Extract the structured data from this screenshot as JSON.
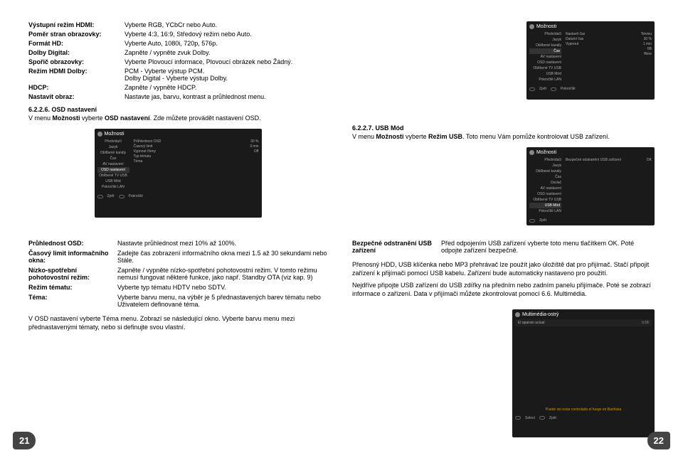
{
  "table1": {
    "rows": [
      {
        "key": "Výstupní režim HDMI:",
        "val": "Vyberte RGB, YCbCr nebo Auto."
      },
      {
        "key": "Poměr stran obrazovky:",
        "val": "Vyberte 4:3, 16:9, Středový režim nebo Auto."
      },
      {
        "key": "Formát HD:",
        "val": "Vyberte Auto, 1080i, 720p, 576p."
      },
      {
        "key": "Dolby Digital:",
        "val": "Zapněte / vypněte zvuk Dolby."
      },
      {
        "key": "Spořič obrazovky:",
        "val": "Vyberte Plovoucí informace, Plovoucí obrázek nebo Žádný."
      },
      {
        "key": "Režim HDMI Dolby:",
        "val": "PCM - Vyberte výstup PCM.\nDolby Digital - Vyberte výstup Dolby."
      },
      {
        "key": "HDCP:",
        "val": "Zapněte / vypněte HDCP."
      },
      {
        "key": "Nastavit obraz:",
        "val": "Nastavte jas, barvu, kontrast a průhlednost menu."
      }
    ]
  },
  "section626": {
    "title": "6.2.2.6. OSD nastavení",
    "text1": "V menu ",
    "bold1": "Možnosti",
    "text2": " vyberte ",
    "bold2": "OSD nastavení",
    "text3": ". Zde můžete provádět nastavení OSD."
  },
  "section627": {
    "title": "6.2.2.7. USB Mód",
    "text1": "V menu ",
    "bold1": "Možnosti",
    "text2": " vyberte ",
    "bold2": "Režim USB",
    "text3": ". Toto menu Vám pomůže kontrolovat USB zařízení."
  },
  "shot1": {
    "title": "Možnosti",
    "left": [
      "Předvídači",
      "Jazyk",
      "Oblíbené kanály",
      "AV nastavení",
      "OSD nastavení",
      "Oblíbené TV USB",
      "USB Mód",
      "Pokročilé LAN"
    ],
    "highlight": "Čas",
    "right": [
      {
        "l": "Nastavit čas",
        "r": "Teivivu"
      },
      {
        "l": "Datum/ čas",
        "r": "30 %"
      },
      {
        "l": "Vypnout",
        "r": "1 min"
      },
      {
        "l": "",
        "r": "6B"
      },
      {
        "l": "",
        "r": "Hline"
      }
    ],
    "footer": [
      "Zpět",
      "Pokročilé"
    ]
  },
  "shot2": {
    "title": "Možnosti",
    "left": [
      "Předvídači",
      "Jazyk",
      "Oblíbené kanály",
      "Čas",
      "AV nastavení",
      "Oblíbené TV USB",
      "USB Mód",
      "Pokročilé LAN"
    ],
    "highlight": "OSD nastavení",
    "right": [
      {
        "l": "Průhlednost OSD",
        "r": "30 %"
      },
      {
        "l": "Časový limit",
        "r": "3 min"
      },
      {
        "l": "Vypnout čteny",
        "r": "Off"
      },
      {
        "l": "Typ tématu",
        "r": ""
      },
      {
        "l": "Téma",
        "r": ""
      }
    ],
    "footer": [
      "Zpět",
      "Pokročilé"
    ]
  },
  "shot3": {
    "title": "Možnosti",
    "left": [
      "Předvídači",
      "Jazyk",
      "Oblíbené kanály",
      "Čas",
      "Osvlač",
      "AV nastavení",
      "OSD nastavení",
      "Oblíbené TV USB",
      "USB Mód",
      "Pokročilé LAN"
    ],
    "highlight": "USB Mód",
    "right": [
      {
        "l": "Bezpečné odstranění USB zařízení",
        "r": "OK"
      }
    ],
    "footer": [
      "Zpět"
    ]
  },
  "shot4": {
    "title": "Multimédia-ostrý",
    "item": "El aparato actual",
    "spanish": "Puede sin estar controlado el fuego en Barińska",
    "footer": [
      "Select",
      "Zpět"
    ]
  },
  "table2": {
    "rows": [
      {
        "key": "Průhlednost OSD:",
        "val": "Nastavte průhlednost mezi 10% až 100%."
      },
      {
        "key": "Časový limit informačního okna:",
        "val": "Zadejte čas zobrazení informačního okna mezi 1.5 až 30 sekundami nebo Stále."
      },
      {
        "key": "Nízko-spotřební pohotovostní režim:",
        "val": "Zapněte / vypněte nízko-spotřební pohotovostní režim. V tomto režimu nemusí fungovat některé funkce, jako např. Standby OTA (viz kap. 9)"
      },
      {
        "key": "Režim tématu:",
        "val": "Vyberte typ tématu HDTV nebo SDTV."
      },
      {
        "key": "Téma:",
        "val": "Vyberte barvu menu, na výběr je 5 přednastavených barev tématu nebo Uživatelem definované téma."
      }
    ]
  },
  "table3": {
    "key": "Bezpečné odstranění USB zařízení",
    "val": "Před odpojením USB zařízení vyberte toto menu tlačítkem OK. Poté odpojte zařízení bezpečně."
  },
  "para1": "Přenosný HDD, USB klíčenka nebo MP3 přehrávač lze použít jako úložiště dat pro přijímač. Stačí připojit zařízení k přijímači pomocí USB kabelu. Zařízení bude automaticky nastaveno pro použití.",
  "para2": "Nejdříve připojte USB zařízení do USB zdířky na předním nebo zadním panelu přijímače. Poté se zobrazí informace o zařízení. Data v přijímači můžete zkontrolovat pomocí 6.6. Multimédia.",
  "para3": "V OSD nastavení vyberte Téma menu. Zobrazí se následující okno. Vyberte barvu menu mezi přednastavenými tématy, nebo si definujte svou vlastní.",
  "pageLeft": "21",
  "pageRight": "22"
}
